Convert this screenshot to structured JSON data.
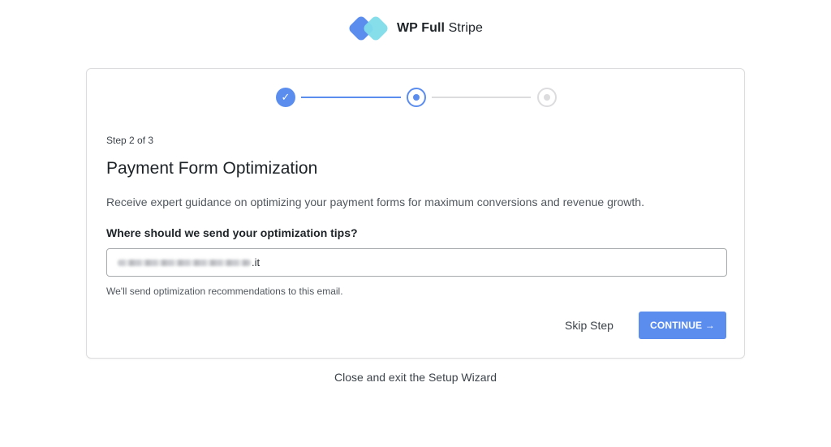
{
  "brand": {
    "name_bold": "WP Full",
    "name_light": "Stripe",
    "colors": {
      "primary": "#5b8def",
      "secondary": "#7fdcea"
    }
  },
  "stepper": {
    "steps": [
      {
        "state": "completed",
        "glyph": "✓"
      },
      {
        "state": "current"
      },
      {
        "state": "upcoming"
      }
    ]
  },
  "wizard": {
    "step_label": "Step 2 of 3",
    "title": "Payment Form Optimization",
    "description": "Receive expert guidance on optimizing your payment forms for maximum conversions and revenue growth.",
    "field_label": "Where should we send your optimization tips?",
    "email_value_visible": ".it",
    "helper_text": "We'll send optimization recommendations to this email.",
    "skip_label": "Skip Step",
    "continue_label": "CONTINUE →"
  },
  "footer": {
    "exit_label": "Close and exit the Setup Wizard"
  }
}
